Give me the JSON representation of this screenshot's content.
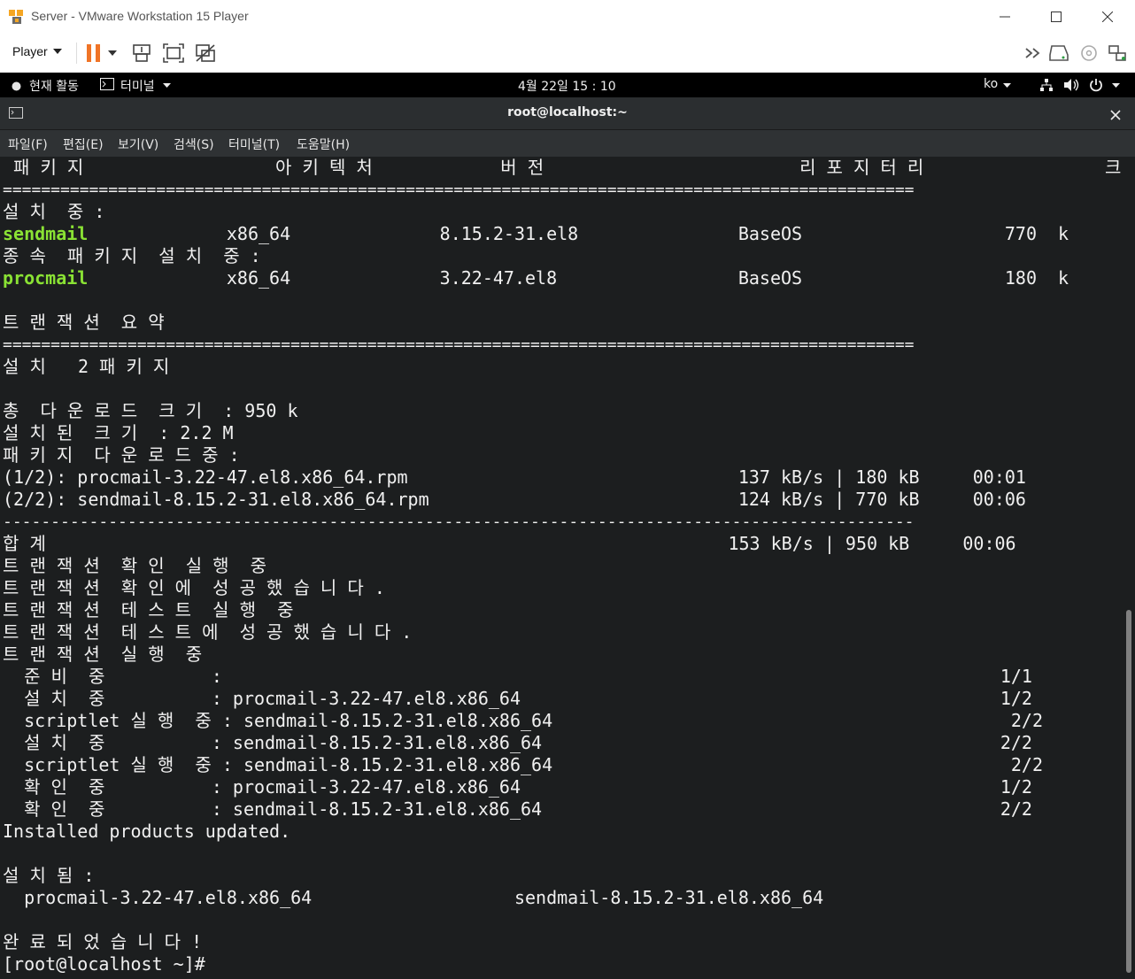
{
  "vmware": {
    "title": "Server - VMware Workstation 15 Player",
    "player_menu": "Player"
  },
  "gnome": {
    "activities": "현재 활동",
    "app_menu": "터미널",
    "clock": "4월 22일  15 : 10",
    "lang": "ko"
  },
  "terminal": {
    "title": "root@localhost:~",
    "menu": [
      "파일(F)",
      "편집(E)",
      "보기(V)",
      "검색(S)",
      "터미널(T)",
      "도움말(H)"
    ],
    "lines": [
      " 패 키 지                  아 키 텍 처            버 전                        리 포 지 터 리                 크 기",
      "===============================================================================================",
      "설 치  중 :",
      "",
      "종 속  패 키 지  설 치  중 :",
      "",
      "",
      "트 랜 잭 션  요 약",
      "===============================================================================================",
      "설 치   2 패 키 지",
      "",
      "총  다 운 로 드  크 기  : 950 k",
      "설 치 된  크 기  : 2.2 M",
      "패 키 지  다 운 로 드 중 :",
      "(1/2): procmail-3.22-47.el8.x86_64.rpm                               137 kB/s | 180 kB     00:01",
      "(2/2): sendmail-8.15.2-31.el8.x86_64.rpm                             124 kB/s | 770 kB     00:06",
      "-----------------------------------------------------------------------------------------------",
      "합 계                                                                153 kB/s | 950 kB     00:06",
      "트 랜 잭 션  확 인  실 행  중",
      "트 랜 잭 션  확 인 에  성 공 했 습 니 다 .",
      "트 랜 잭 션  테 스 트  실 행  중",
      "트 랜 잭 션  테 스 트 에  성 공 했 습 니 다 .",
      "트 랜 잭 션  실 행  중",
      "  준 비  중          :                                                                         1/1",
      "  설 치  중          : procmail-3.22-47.el8.x86_64                                             1/2",
      "  scriptlet 실 행  중 : sendmail-8.15.2-31.el8.x86_64                                           2/2",
      "  설 치  중          : sendmail-8.15.2-31.el8.x86_64                                           2/2",
      "  scriptlet 실 행  중 : sendmail-8.15.2-31.el8.x86_64                                           2/2",
      "  확 인  중          : procmail-3.22-47.el8.x86_64                                             1/2",
      "  확 인  중          : sendmail-8.15.2-31.el8.x86_64                                           2/2",
      "Installed products updated.",
      "",
      "설 치 됨 :",
      "  procmail-3.22-47.el8.x86_64                   sendmail-8.15.2-31.el8.x86_64",
      "",
      "완 료 되 었 습 니 다 !",
      "[root@localhost ~]#"
    ],
    "pkg_rows": [
      {
        "name": "sendmail",
        "rest": "             x86_64              8.15.2-31.el8               BaseOS                   770  k"
      },
      {
        "name": "procmail",
        "rest": "             x86_64              3.22-47.el8                 BaseOS                   180  k"
      }
    ]
  }
}
